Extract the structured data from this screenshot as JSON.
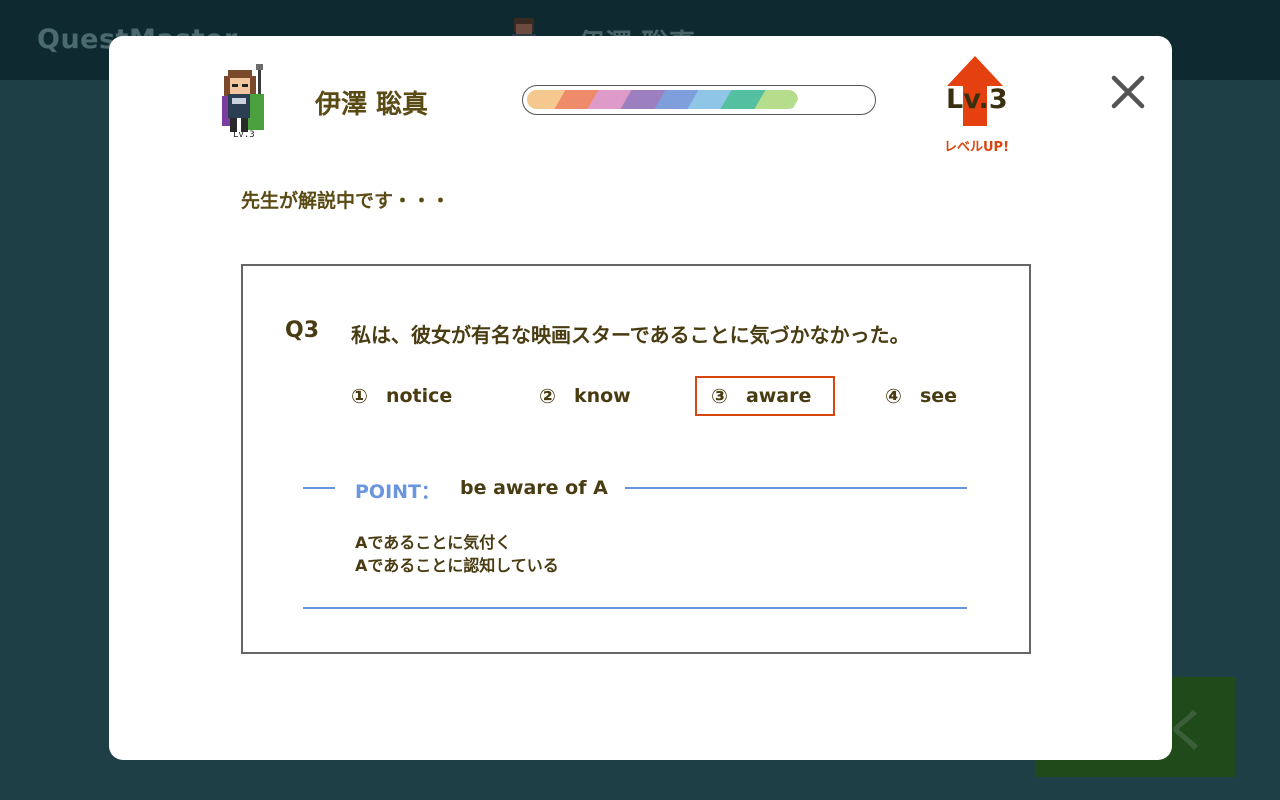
{
  "background": {
    "app_title": "QuestMaster",
    "player_name": "伊澤 聡真",
    "level_short": "Lv.3",
    "action_button": "解く"
  },
  "modal": {
    "player": {
      "name": "伊澤 聡真",
      "avatar_level": "Lv.3",
      "avatar_icon": "pixel-warrior-icon"
    },
    "xp_bar": {
      "progress": 0.79,
      "colors": [
        "#f4c88e",
        "#ef8a6a",
        "#de9ac8",
        "#9c7fbf",
        "#7f9fdc",
        "#8fc5e6",
        "#55c0a0",
        "#b5dd8c"
      ]
    },
    "level": {
      "value": "Lv.3",
      "label": "レベルUP!",
      "arrow_color": "#e5400f"
    },
    "status": "先生が解説中です・・・",
    "question": {
      "number": "Q3",
      "text": "私は、彼女が有名な映画スターであることに気づかなかった。",
      "choices": [
        {
          "num": "①",
          "label": "notice",
          "selected": false
        },
        {
          "num": "②",
          "label": "know",
          "selected": false
        },
        {
          "num": "③",
          "label": "aware",
          "selected": true
        },
        {
          "num": "④",
          "label": "see",
          "selected": false
        }
      ]
    },
    "point": {
      "label": "POINT：",
      "phrase": "be aware of A",
      "meanings": [
        "Aであることに気付く",
        "Aであることに認知している"
      ]
    },
    "close_icon": "close-icon",
    "colors": {
      "text": "#4a3c12",
      "accent": "#d9450f",
      "point": "#6a96e0"
    }
  }
}
